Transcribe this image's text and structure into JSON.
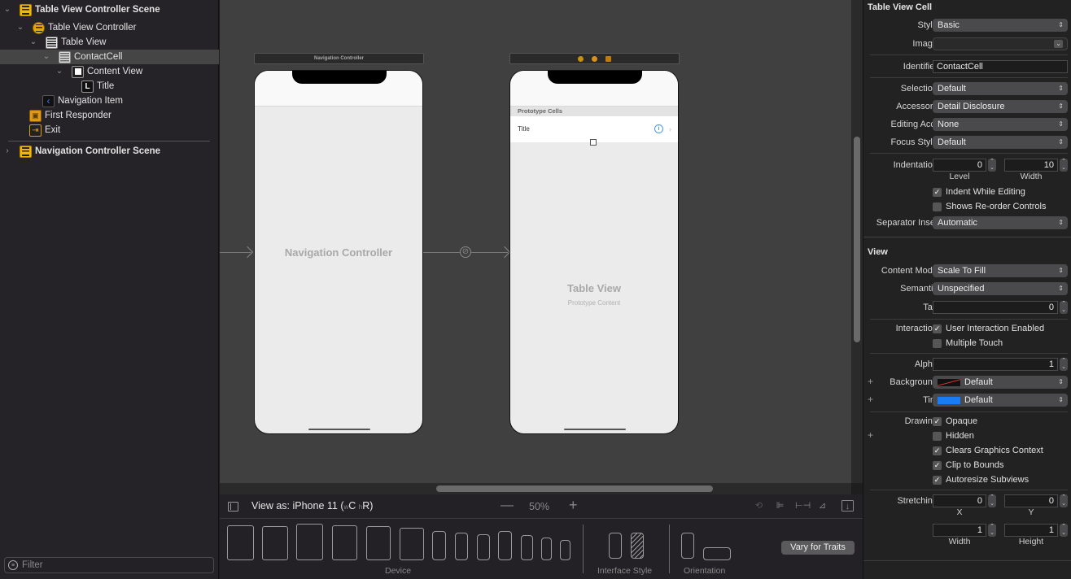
{
  "navigator": {
    "items": [
      {
        "label": "Table View Controller Scene",
        "icon": "scene-icon",
        "expanded": true,
        "level": 0,
        "bold": true
      },
      {
        "label": "Table View Controller",
        "icon": "view-controller-icon",
        "expanded": true,
        "level": 1
      },
      {
        "label": "Table View",
        "icon": "table-view-icon",
        "expanded": true,
        "level": 2
      },
      {
        "label": "ContactCell",
        "icon": "table-cell-icon",
        "expanded": true,
        "level": 3,
        "selected": true
      },
      {
        "label": "Content View",
        "icon": "content-view-icon",
        "expanded": true,
        "level": 4
      },
      {
        "label": "Title",
        "icon": "label-icon",
        "level": 5
      },
      {
        "label": "Navigation Item",
        "icon": "navigation-item-icon",
        "level": 2
      },
      {
        "label": "First Responder",
        "icon": "first-responder-icon",
        "level": 1
      },
      {
        "label": "Exit",
        "icon": "exit-icon",
        "level": 1
      },
      {
        "label": "Navigation Controller Scene",
        "icon": "scene-icon",
        "expanded": false,
        "level": 0,
        "bold": true
      }
    ],
    "filter_placeholder": "Filter"
  },
  "canvas": {
    "nav_controller": {
      "bar_title": "Navigation Controller",
      "placeholder": "Navigation Controller"
    },
    "table_controller": {
      "section_header": "Prototype Cells",
      "cell_title": "Title",
      "placeholder_title": "Table View",
      "placeholder_subtitle": "Prototype Content"
    }
  },
  "bottom_bar": {
    "view_as_prefix": "View as: iPhone 11 (",
    "w_size": "w",
    "w_class": "C",
    "h_size": "h",
    "h_class": "R",
    "close_paren": ")",
    "zoom_minus": "—",
    "zoom_level": "50%",
    "zoom_plus": "+",
    "device_label": "Device",
    "interface_style_label": "Interface Style",
    "orientation_label": "Orientation",
    "vary_button": "Vary for Traits"
  },
  "inspector": {
    "cell_section": "Table View Cell",
    "style": {
      "label": "Style",
      "value": "Basic"
    },
    "image": {
      "label": "Image",
      "value": ""
    },
    "identifier": {
      "label": "Identifier",
      "value": "ContactCell"
    },
    "selection": {
      "label": "Selection",
      "value": "Default"
    },
    "accessory": {
      "label": "Accessory",
      "value": "Detail Disclosure"
    },
    "editing_acc": {
      "label": "Editing Acc.",
      "value": "None"
    },
    "focus_style": {
      "label": "Focus Style",
      "value": "Default"
    },
    "indentation": {
      "label": "Indentation",
      "level": "0",
      "width": "10",
      "level_label": "Level",
      "width_label": "Width"
    },
    "indent_while_editing": {
      "label": "Indent While Editing",
      "checked": true
    },
    "shows_reorder": {
      "label": "Shows Re-order Controls",
      "checked": false
    },
    "separator_inset": {
      "label": "Separator Inset",
      "value": "Automatic"
    },
    "view_section": "View",
    "content_mode": {
      "label": "Content Mode",
      "value": "Scale To Fill"
    },
    "semantic": {
      "label": "Semantic",
      "value": "Unspecified"
    },
    "tag": {
      "label": "Tag",
      "value": "0"
    },
    "interaction": {
      "label": "Interaction",
      "user_interaction": "User Interaction Enabled",
      "user_interaction_checked": true,
      "multiple_touch": "Multiple Touch",
      "multiple_touch_checked": false
    },
    "alpha": {
      "label": "Alpha",
      "value": "1"
    },
    "background": {
      "label": "Background",
      "value": "Default"
    },
    "tint": {
      "label": "Tint",
      "value": "Default",
      "color": "#1a7cf5"
    },
    "drawing": {
      "label": "Drawing",
      "opaque": "Opaque",
      "hidden": "Hidden",
      "clears": "Clears Graphics Context",
      "clip": "Clip to Bounds",
      "autoresize": "Autoresize Subviews"
    },
    "stretching": {
      "label": "Stretching",
      "x": "0",
      "y": "0",
      "width": "1",
      "height": "1",
      "x_label": "X",
      "y_label": "Y",
      "width_label": "Width",
      "height_label": "Height"
    }
  }
}
